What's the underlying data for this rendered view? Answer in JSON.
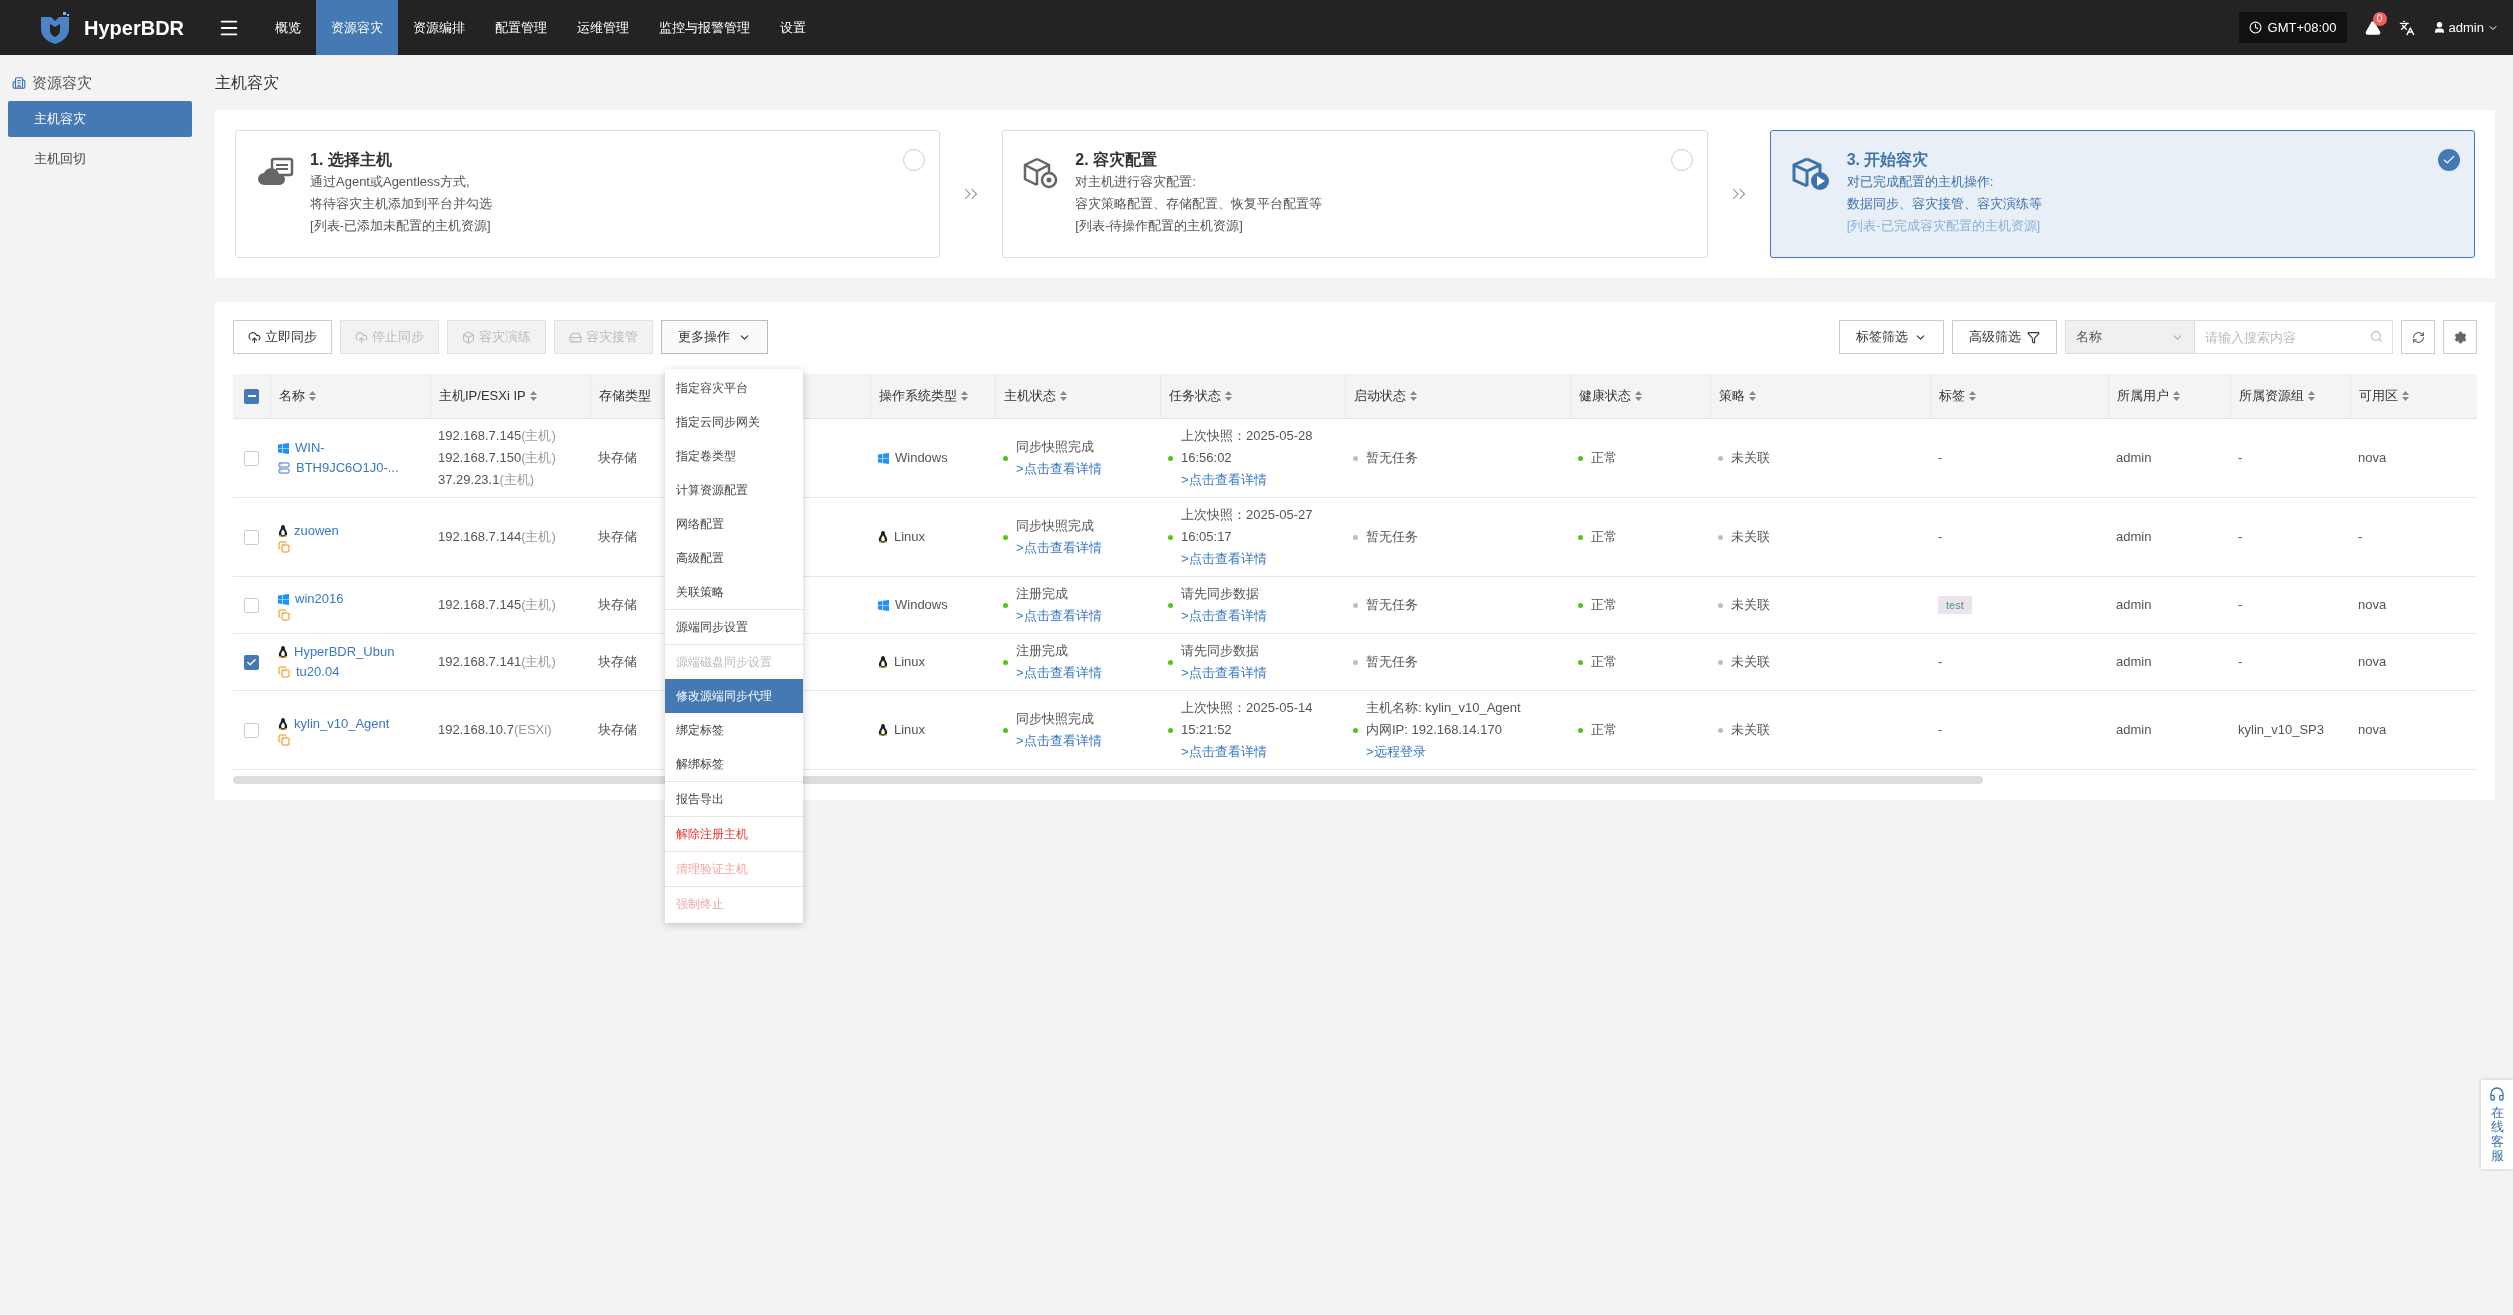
{
  "topbar": {
    "brand": "HyperBDR",
    "nav": [
      {
        "label": "概览",
        "selected": false
      },
      {
        "label": "资源容灾",
        "selected": true
      },
      {
        "label": "资源编排",
        "selected": false
      },
      {
        "label": "配置管理",
        "selected": false
      },
      {
        "label": "运维管理",
        "selected": false
      },
      {
        "label": "监控与报警管理",
        "selected": false
      },
      {
        "label": "设置",
        "selected": false
      }
    ],
    "timezone": "GMT+08:00",
    "alert_count": "0",
    "user": "admin"
  },
  "sidebar": {
    "title": "资源容灾",
    "items": [
      {
        "label": "主机容灾",
        "selected": true
      },
      {
        "label": "主机回切",
        "selected": false
      }
    ]
  },
  "page_title": "主机容灾",
  "steps": [
    {
      "title": "1. 选择主机",
      "lines": [
        "通过Agent或Agentless方式,",
        "将待容灾主机添加到平台并勾选"
      ],
      "note": "[列表-已添加未配置的主机资源]",
      "selected": false,
      "kind": "cloud"
    },
    {
      "title": "2. 容灾配置",
      "lines": [
        "对主机进行容灾配置:",
        "容灾策略配置、存储配置、恢复平台配置等"
      ],
      "note": "[列表-待操作配置的主机资源]",
      "selected": false,
      "kind": "config"
    },
    {
      "title": "3. 开始容灾",
      "lines": [
        "对已完成配置的主机操作:",
        "数据同步、容灾接管、容灾演练等"
      ],
      "note": "[列表-已完成容灾配置的主机资源]",
      "selected": true,
      "kind": "play"
    }
  ],
  "toolbar": {
    "actions": [
      {
        "label": "立即同步",
        "disabled": false,
        "kind": "cloud"
      },
      {
        "label": "停止同步",
        "disabled": true,
        "kind": "cloud"
      },
      {
        "label": "容灾演练",
        "disabled": true,
        "kind": "drill"
      },
      {
        "label": "容灾接管",
        "disabled": true,
        "kind": "takeover"
      }
    ],
    "more": {
      "label": "更多操作",
      "expanded": true
    },
    "tag_filter": "标签筛选",
    "advanced_filter": "高级筛选",
    "search_field": "名称",
    "search": {
      "placeholder": "请输入搜索内容"
    }
  },
  "menu": {
    "sections": [
      [
        {
          "label": "指定容灾平台",
          "kind": "normal",
          "selected": false
        },
        {
          "label": "指定云同步网关",
          "kind": "normal",
          "selected": false
        },
        {
          "label": "指定卷类型",
          "kind": "normal",
          "selected": false
        },
        {
          "label": "计算资源配置",
          "kind": "normal",
          "selected": false
        },
        {
          "label": "网络配置",
          "kind": "normal",
          "selected": false
        },
        {
          "label": "高级配置",
          "kind": "normal",
          "selected": false
        },
        {
          "label": "关联策略",
          "kind": "normal",
          "selected": false
        }
      ],
      [
        {
          "label": "源端同步设置",
          "kind": "normal",
          "selected": false
        }
      ],
      [
        {
          "label": "源端磁盘同步设置",
          "kind": "disabled",
          "selected": false
        },
        {
          "label": "修改源端同步代理",
          "kind": "normal",
          "selected": true
        },
        {
          "label": "绑定标签",
          "kind": "normal",
          "selected": false
        },
        {
          "label": "解绑标签",
          "kind": "normal",
          "selected": false
        }
      ],
      [
        {
          "label": "报告导出",
          "kind": "normal",
          "selected": false
        }
      ],
      [
        {
          "label": "解除注册主机",
          "kind": "danger",
          "selected": false
        }
      ],
      [
        {
          "label": "清理验证主机",
          "kind": "danger_disabled",
          "selected": false
        }
      ],
      [
        {
          "label": "强制终止",
          "kind": "danger_disabled",
          "selected": false
        }
      ]
    ]
  },
  "table": {
    "some_checked": true,
    "columns": [
      "名称",
      "主机IP/ESXi IP",
      "存储类型",
      "操作系统类型",
      "主机状态",
      "任务状态",
      "启动状态",
      "健康状态",
      "策略",
      "标签",
      "所属用户",
      "所属资源组",
      "可用区"
    ],
    "rows": [
      {
        "checked": false,
        "name_lines": [
          "WIN-",
          "BTH9JC6O1J0-..."
        ],
        "kind": "primary",
        "ips": [
          {
            "address": "192.168.7.145",
            "role": "(主机)"
          },
          {
            "address": "192.168.7.150",
            "role": "(主机)"
          },
          {
            "address": "37.29.23.1",
            "role": "(主机)"
          }
        ],
        "storage": "块存储",
        "os": {
          "kind": "windows",
          "label": "Windows"
        },
        "host_state": {
          "color": "#52c41a",
          "lines": [
            "同步快照完成"
          ],
          "link": ">点击查看详情"
        },
        "task_state": {
          "color": "#52c41a",
          "lines": [
            "上次快照：2025-05-28",
            "16:56:02"
          ],
          "link": ">点击查看详情"
        },
        "boot_state": {
          "color": "#bfbfbf",
          "lines": [
            "暂无任务"
          ]
        },
        "health": {
          "color": "#52c41a",
          "text": "正常"
        },
        "policy": {
          "color": "#bfbfbf",
          "text": "未关联"
        },
        "tag": {
          "kind": "none",
          "text": "-"
        },
        "user": "admin",
        "group": "-",
        "zone": "nova"
      },
      {
        "checked": false,
        "name_lines": [
          "zuowen"
        ],
        "kind": "secondary",
        "ips": [
          {
            "address": "192.168.7.144",
            "role": "(主机)"
          }
        ],
        "storage": "块存储",
        "os": {
          "kind": "linux",
          "label": "Linux"
        },
        "host_state": {
          "color": "#52c41a",
          "lines": [
            "同步快照完成"
          ],
          "link": ">点击查看详情"
        },
        "task_state": {
          "color": "#52c41a",
          "lines": [
            "上次快照：2025-05-27",
            "16:05:17"
          ],
          "link": ">点击查看详情"
        },
        "boot_state": {
          "color": "#bfbfbf",
          "lines": [
            "暂无任务"
          ]
        },
        "health": {
          "color": "#52c41a",
          "text": "正常"
        },
        "policy": {
          "color": "#bfbfbf",
          "text": "未关联"
        },
        "tag": {
          "kind": "none",
          "text": "-"
        },
        "user": "admin",
        "group": "-",
        "zone": "-"
      },
      {
        "checked": false,
        "name_lines": [
          "win2016"
        ],
        "kind": "secondary",
        "ips": [
          {
            "address": "192.168.7.145",
            "role": "(主机)"
          }
        ],
        "storage": "块存储",
        "os": {
          "kind": "windows",
          "label": "Windows"
        },
        "host_state": {
          "color": "#52c41a",
          "lines": [
            "注册完成"
          ],
          "link": ">点击查看详情"
        },
        "task_state": {
          "color": "#52c41a",
          "lines": [
            "请先同步数据"
          ],
          "link": ">点击查看详情"
        },
        "boot_state": {
          "color": "#bfbfbf",
          "lines": [
            "暂无任务"
          ]
        },
        "health": {
          "color": "#52c41a",
          "text": "正常"
        },
        "policy": {
          "color": "#bfbfbf",
          "text": "未关联"
        },
        "tag": {
          "kind": "tag",
          "text": "test"
        },
        "user": "admin",
        "group": "-",
        "zone": "nova"
      },
      {
        "checked": true,
        "name_lines": [
          "HyperBDR_Ubun",
          "tu20.04"
        ],
        "kind": "secondary",
        "ips": [
          {
            "address": "192.168.7.141",
            "role": "(主机)"
          }
        ],
        "storage": "块存储",
        "os": {
          "kind": "linux",
          "label": "Linux"
        },
        "host_state": {
          "color": "#52c41a",
          "lines": [
            "注册完成"
          ],
          "link": ">点击查看详情"
        },
        "task_state": {
          "color": "#52c41a",
          "lines": [
            "请先同步数据"
          ],
          "link": ">点击查看详情"
        },
        "boot_state": {
          "color": "#bfbfbf",
          "lines": [
            "暂无任务"
          ]
        },
        "health": {
          "color": "#52c41a",
          "text": "正常"
        },
        "policy": {
          "color": "#bfbfbf",
          "text": "未关联"
        },
        "tag": {
          "kind": "none",
          "text": "-"
        },
        "user": "admin",
        "group": "-",
        "zone": "nova"
      },
      {
        "checked": false,
        "name_lines": [
          "kylin_v10_Agent"
        ],
        "kind": "secondary",
        "ips": [
          {
            "address": "192.168.10.7",
            "role": "(ESXi)"
          }
        ],
        "storage": "块存储",
        "os": {
          "kind": "linux",
          "label": "Linux"
        },
        "host_state": {
          "color": "#52c41a",
          "lines": [
            "同步快照完成"
          ],
          "link": ">点击查看详情"
        },
        "task_state": {
          "color": "#52c41a",
          "lines": [
            "上次快照：2025-05-14",
            "15:21:52"
          ],
          "link": ">点击查看详情"
        },
        "boot_state": {
          "color": "#52c41a",
          "lines": [
            "主机名称: kylin_v10_Agent",
            "内网IP: 192.168.14.170"
          ],
          "link": ">远程登录"
        },
        "health": {
          "color": "#52c41a",
          "text": "正常"
        },
        "policy": {
          "color": "#bfbfbf",
          "text": "未关联"
        },
        "tag": {
          "kind": "none",
          "text": "-"
        },
        "user": "admin",
        "group": "kylin_v10_SP3",
        "zone": "nova"
      }
    ]
  },
  "support_widget": "在线客服"
}
